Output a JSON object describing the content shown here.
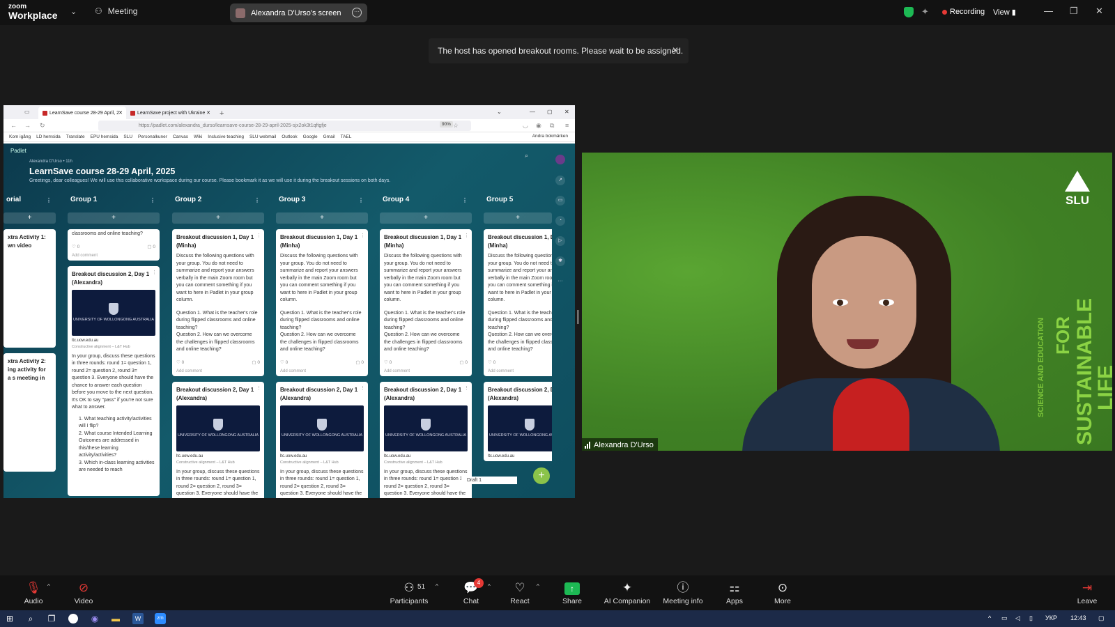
{
  "app": {
    "brand_line1": "zoom",
    "brand_line2": "Workplace",
    "meeting_label": "Meeting",
    "share_pill": "Alexandra D'Urso's screen",
    "recording_label": "Recording",
    "view_label": "View"
  },
  "toast": {
    "message": "The host has opened breakout rooms. Please wait to be assigned."
  },
  "browser": {
    "tabs": [
      {
        "label": "LearnSave course 28-29 April, 2"
      },
      {
        "label": "LearnSave project with Ukraine"
      }
    ],
    "url": "https://padlet.com/alexandra_durso/learnsave-course-28-29-april-2025-sjx2ok3t1qftgfje",
    "zoom": "90%",
    "bookmarks": [
      "Kom igång",
      "LD hemsida",
      "Translate",
      "EPU hemsida",
      "SLU",
      "Personalkuner",
      "Canvas",
      "Wiki",
      "Inclusive teaching",
      "SLU webmail",
      "Outlook",
      "Google",
      "Gmail",
      "TAEL"
    ],
    "other_bookmarks": "Andra bokmärken"
  },
  "padlet": {
    "brand": "Padlet",
    "author": "Alexandra D'Urso • 11h",
    "title": "LearnSave course 28-29 April, 2025",
    "description": "Greetings, dear colleagues! We will use this collaborative workspace during our course. Please bookmark it as we will use it during the breakout sessions on both days.",
    "columns": [
      {
        "title": "Group 1"
      },
      {
        "title": "Group 2"
      },
      {
        "title": "Group 3"
      },
      {
        "title": "Group 4"
      },
      {
        "title": "Group 5"
      }
    ],
    "partial_column": "orial",
    "partial_cards": [
      "xtra Activity 1: wn video",
      "xtra Activity 2: ing activity for a s meeting in"
    ],
    "g1_top_text": "classrooms and online teaching?",
    "card1_title": "Breakout discussion 1, Day 1 (Minha)",
    "card1_body": "Discuss the following questions with your group. You do not need to summarize and report your answers verbally in the main Zoom room but you can comment something if you want to here in Padlet in your group column.",
    "card1_q1": "Question 1. What is the teacher's role during flipped classrooms and online teaching?",
    "card1_q2": "Question 2. How can we overcome the challenges in flipped classrooms and online teaching?",
    "card2_title": "Breakout discussion 2, Day 1 (Alexandra)",
    "uow_name": "UNIVERSITY OF WOLLONGONG AUSTRALIA",
    "uow_domain": "ltc.uow.edu.au",
    "uow_source": "Constructive alignment – L&T Hub",
    "card2_body": "In your group, discuss these questions in three rounds: round 1= question 1, round 2= question 2, round 3= question 3. Everyone should have the chance to answer each question before you move to the next question. It's OK to say \"pass\" if you're not sure what to answer.",
    "card2_list1": "What teaching activity/activities will I flip?",
    "card2_list2": "What course Intended Learning Outcomes are addressed in this/these learning activity/activities?",
    "card2_list3": "Which in-class learning activities are needed to reach",
    "like_count": "0",
    "comment_count": "0",
    "add_comment": "Add comment",
    "draft": "Draft 1"
  },
  "video": {
    "participant_name": "Alexandra D'Urso",
    "logo_text": "SLU",
    "overlay_science": "SCIENCE AND EDUCATION",
    "overlay_for": "FOR",
    "overlay_sustainable": "SUSTAINABLE",
    "overlay_life": "LIFE"
  },
  "toolbar": {
    "audio": "Audio",
    "video": "Video",
    "participants": "Participants",
    "participants_count": "51",
    "chat": "Chat",
    "chat_badge": "4",
    "react": "React",
    "share": "Share",
    "ai_companion": "AI Companion",
    "meeting_info": "Meeting info",
    "apps": "Apps",
    "more": "More",
    "leave": "Leave"
  },
  "taskbar": {
    "lang": "УКР",
    "time": "12:43"
  },
  "colors": {
    "recording_dot": "#e53935",
    "share_green": "#1db954",
    "padlet_bg": "#135a6a",
    "slu_green": "#4a8f2a"
  }
}
